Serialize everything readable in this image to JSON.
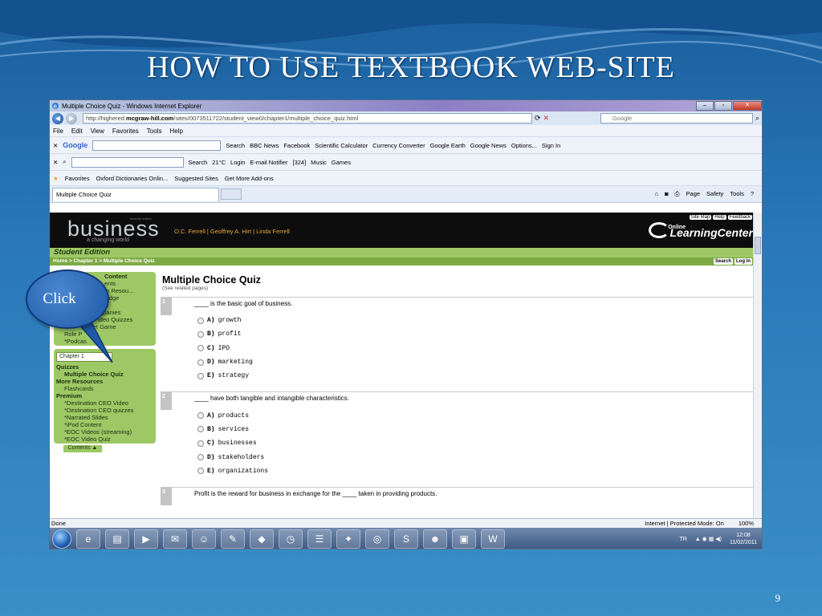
{
  "slide": {
    "title": "HOW TO USE TEXTBOOK WEB-SITE",
    "page_number": "9"
  },
  "browser": {
    "window_title": "Multiple Choice Quiz - Windows Internet Explorer",
    "url_prefix": "http://highered.",
    "url_domain": "mcgraw-hill.com",
    "url_path": "/sites/0073511722/student_view0/chapter1/multiple_choice_quiz.html",
    "search_placeholder": "Google",
    "menu": [
      "File",
      "Edit",
      "View",
      "Favorites",
      "Tools",
      "Help"
    ],
    "google_toolbar": [
      "Google",
      "Search",
      "BBC News",
      "Facebook",
      "Scientific Calculator",
      "Currency Converter",
      "Google Earth",
      "Google News",
      "Options...",
      "Sign In"
    ],
    "second_toolbar": [
      "Search",
      "21°C",
      "Login",
      "E-mail Notifier",
      "[324]",
      "Music",
      "Games"
    ],
    "favorites": [
      "Favorites",
      "Oxford Dictionaries Onlin...",
      "Suggested Sites",
      "Get More Add-ons"
    ],
    "tab_label": "Multiple Choice Quiz",
    "commands": [
      "Page",
      "Safety",
      "Tools"
    ],
    "status_left": "Done",
    "status_zone": "Internet | Protected Mode: On",
    "zoom": "100%"
  },
  "site": {
    "logo": "business",
    "logo_tagline": "a changing world",
    "logo_edition": "seventh edition",
    "authors": "O.C. Ferrell | Geoffrey A. Hirt | Linda Ferrell",
    "olc_small": "Online",
    "olc_big": "LearningCenter",
    "top_links": [
      "Site Map",
      "Help",
      "Feedback"
    ],
    "edition_label": "Student Edition",
    "breadcrumb": "Home > Chapter 1 > Multiple Choice Quiz",
    "crumb_buttons": [
      "Search",
      "Log In"
    ]
  },
  "sidebar": {
    "top_items": [
      "Content",
      "ents",
      "m Resou...",
      "ledge",
      "",
      "mpanies",
      "ideo Quizzes",
      "ket Game",
      "Role P",
      "*Podcas"
    ],
    "chapter_select": "Chapter 1",
    "quizzes_header": "Quizzes",
    "quiz_item": "Multiple Choice Quiz",
    "more_header": "More Resources",
    "more_items": [
      "Flashcards"
    ],
    "premium_header": "Premium",
    "premium_items": [
      "*Destination CEO Video",
      "*Destination CEO quizzes",
      "*Narrated Slides",
      "*iPod Content",
      "*EOC Videos (streaming)",
      "*EOC Video Quiz"
    ],
    "contents_button": "Contents"
  },
  "quiz": {
    "title": "Multiple Choice Quiz",
    "subtitle": "(See related pages)",
    "questions": [
      {
        "num": "1",
        "text": "____ is the basic goal of business.",
        "options": [
          [
            "A)",
            "growth"
          ],
          [
            "B)",
            "profit"
          ],
          [
            "C)",
            "IPO"
          ],
          [
            "D)",
            "marketing"
          ],
          [
            "E)",
            "strategy"
          ]
        ]
      },
      {
        "num": "2",
        "text": "____ have both tangible and intangible characteristics.",
        "options": [
          [
            "A)",
            "products"
          ],
          [
            "B)",
            "services"
          ],
          [
            "C)",
            "businesses"
          ],
          [
            "D)",
            "stakeholders"
          ],
          [
            "E)",
            "organizations"
          ]
        ]
      },
      {
        "num": "3",
        "text": "Profit is the reward for business in exchange for the ____ taken in providing products.",
        "options": []
      }
    ]
  },
  "taskbar": {
    "lang": "TR",
    "time": "12:08",
    "date": "11/02/2011"
  },
  "callout": {
    "label": "Click"
  }
}
